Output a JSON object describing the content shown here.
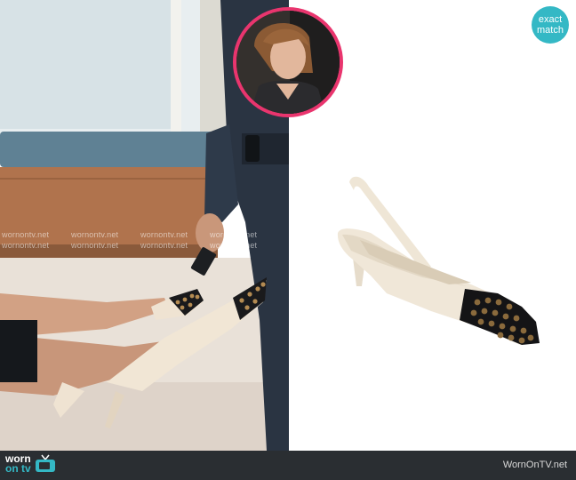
{
  "badge": {
    "line1": "exact",
    "line2": "match"
  },
  "footer": {
    "logo_worn": "worn",
    "logo_ontv": "on tv",
    "site": "WornOnTV.net"
  },
  "watermark": "wornontv.net",
  "colors": {
    "badge": "#34b8c5",
    "ring": "#e9356e",
    "footer_bg": "#2a2e32",
    "shoe_leather": "#efe6d6",
    "shoe_toe": "#1b1b1d"
  }
}
